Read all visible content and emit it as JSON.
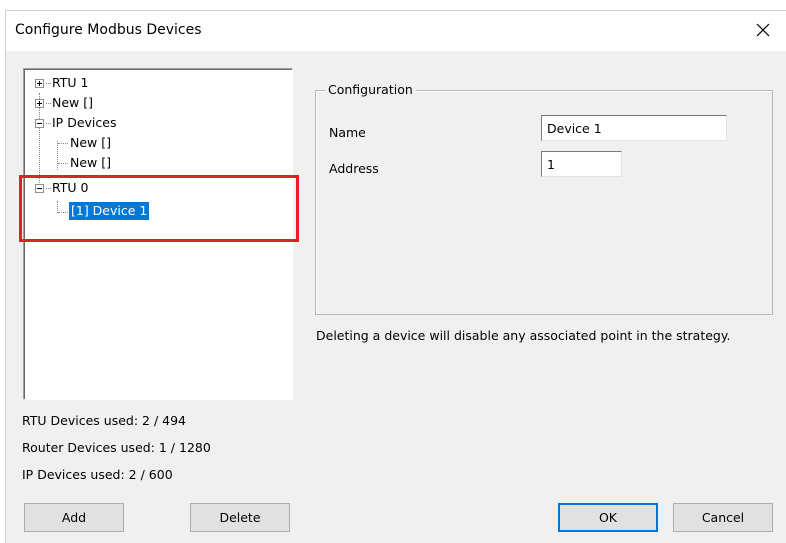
{
  "window": {
    "title": "Configure Modbus Devices"
  },
  "tree": {
    "nodes": [
      {
        "label": "RTU 1",
        "expander": "plus"
      },
      {
        "label": "New []",
        "expander": "plus"
      },
      {
        "label": "IP Devices",
        "expander": "minus"
      },
      {
        "label": "New []"
      },
      {
        "label": "New []"
      },
      {
        "label": "RTU 0",
        "expander": "minus"
      },
      {
        "label": "[1] Device 1",
        "selected": true
      }
    ]
  },
  "configuration": {
    "legend": "Configuration",
    "name_label": "Name",
    "name_value": "Device 1",
    "address_label": "Address",
    "address_value": "1"
  },
  "note": "Deleting a device will disable any associated point in the strategy.",
  "stats": {
    "rtu": "RTU Devices used: 2 / 494",
    "router": "Router Devices used: 1 / 1280",
    "ip": "IP Devices used: 2 / 600"
  },
  "buttons": {
    "add": "Add",
    "delete": "Delete",
    "ok": "OK",
    "cancel": "Cancel"
  },
  "colors": {
    "selection": "#0078d7",
    "highlight_border": "#e02128",
    "dialog_bg": "#f0f0f0"
  },
  "icons": {
    "close": "close-icon",
    "expand": "plus-box-icon",
    "collapse": "minus-box-icon"
  }
}
